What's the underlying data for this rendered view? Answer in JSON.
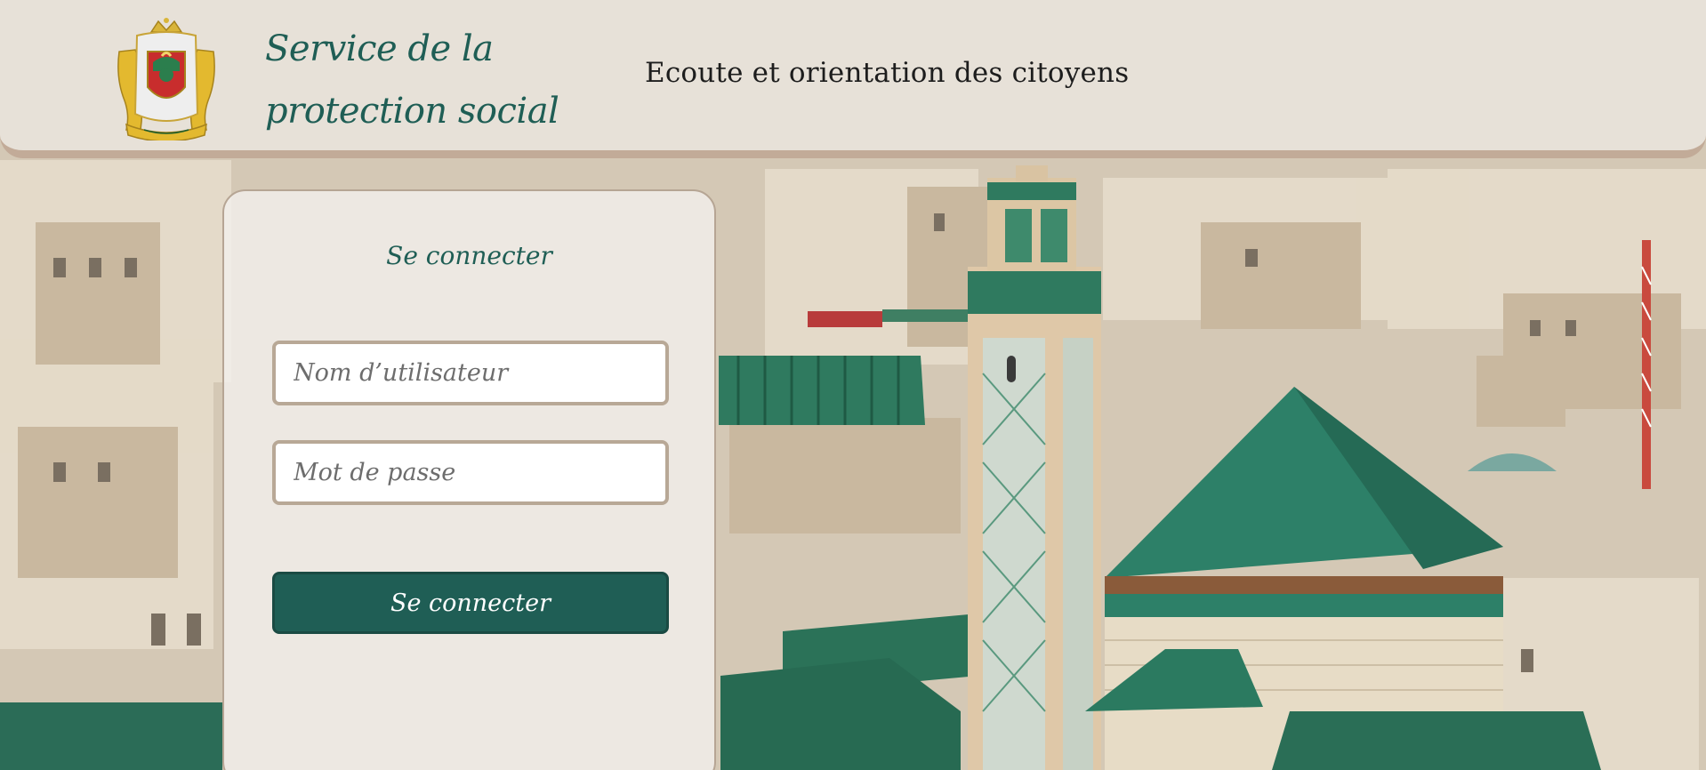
{
  "header": {
    "brand_line1": "Service de la",
    "brand_line2": "protection social",
    "tagline": "Ecoute et orientation des citoyens",
    "emblem": "royal-coat-of-arms-emblem"
  },
  "login": {
    "title": "Se connecter",
    "username_placeholder": "Nom d’utilisateur",
    "username_value": "",
    "password_placeholder": "Mot de passe",
    "password_value": "",
    "submit_label": "Se connecter"
  },
  "background": {
    "description_icon": "city-skyline-with-minaret-photo"
  },
  "colors": {
    "brand_green": "#1f5e55",
    "header_border": "#c2ab98",
    "field_border": "#b8a896"
  }
}
